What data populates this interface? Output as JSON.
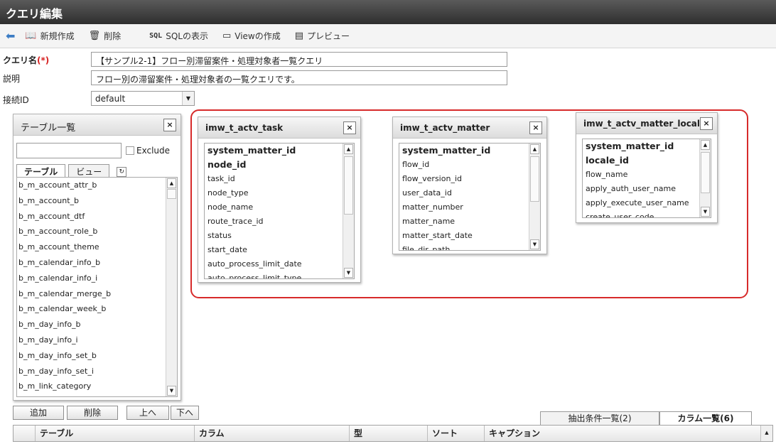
{
  "window": {
    "title": "クエリ編集"
  },
  "toolbar": {
    "back_icon": "back-arrow-icon",
    "new_label": "新規作成",
    "delete_label": "削除",
    "sql_badge": "SQL",
    "sql_label": "SQLの表示",
    "view_label": "Viewの作成",
    "preview_label": "プレビュー"
  },
  "form": {
    "query_name_label": "クエリ名",
    "required_mark": "(*)",
    "query_name_value": "【サンプル2-1】フロー別滞留案件・処理対象者一覧クエリ",
    "description_label": "説明",
    "description_value": "フロー別の滞留案件・処理対象者の一覧クエリです。",
    "connection_label": "接続ID",
    "connection_value": "default"
  },
  "table_list": {
    "title": "テーブル一覧",
    "close": "×",
    "search_value": "",
    "exclude_label": "Exclude",
    "tabs": [
      {
        "label": "テーブル"
      },
      {
        "label": "ビュー"
      }
    ],
    "items": [
      "b_m_account_attr_b",
      "b_m_account_b",
      "b_m_account_dtf",
      "b_m_account_role_b",
      "b_m_account_theme",
      "b_m_calendar_info_b",
      "b_m_calendar_info_i",
      "b_m_calendar_merge_b",
      "b_m_calendar_week_b",
      "b_m_day_info_b",
      "b_m_day_info_i",
      "b_m_day_info_set_b",
      "b_m_day_info_set_i",
      "b_m_link_category"
    ]
  },
  "tables": [
    {
      "name": "imw_t_actv_task",
      "close": "×",
      "key_fields": [
        "system_matter_id",
        "node_id"
      ],
      "fields": [
        "task_id",
        "node_type",
        "node_name",
        "route_trace_id",
        "status",
        "start_date",
        "auto_process_limit_date",
        "auto_process_limit_type"
      ]
    },
    {
      "name": "imw_t_actv_matter",
      "close": "×",
      "key_fields": [
        "system_matter_id"
      ],
      "fields": [
        "flow_id",
        "flow_version_id",
        "user_data_id",
        "matter_number",
        "matter_name",
        "matter_start_date",
        "file_dir_path"
      ]
    },
    {
      "name": "imw_t_actv_matter_locale",
      "close": "×",
      "key_fields": [
        "system_matter_id",
        "locale_id"
      ],
      "fields": [
        "flow_name",
        "apply_auth_user_name",
        "apply_execute_user_name",
        "create_user_code"
      ]
    }
  ],
  "actions": {
    "add": "追加",
    "delete": "削除",
    "up": "上へ",
    "down": "下へ"
  },
  "bottom_tabs": [
    {
      "label": "抽出条件一覧(2)"
    },
    {
      "label": "カラム一覧(6)"
    }
  ],
  "grid": {
    "columns": [
      "テーブル",
      "カラム",
      "型",
      "ソート",
      "キャプション"
    ]
  },
  "colors": {
    "highlight": "#d72a2a",
    "title_bar": "#3a3a3a",
    "accent": "#3b7cc4"
  }
}
